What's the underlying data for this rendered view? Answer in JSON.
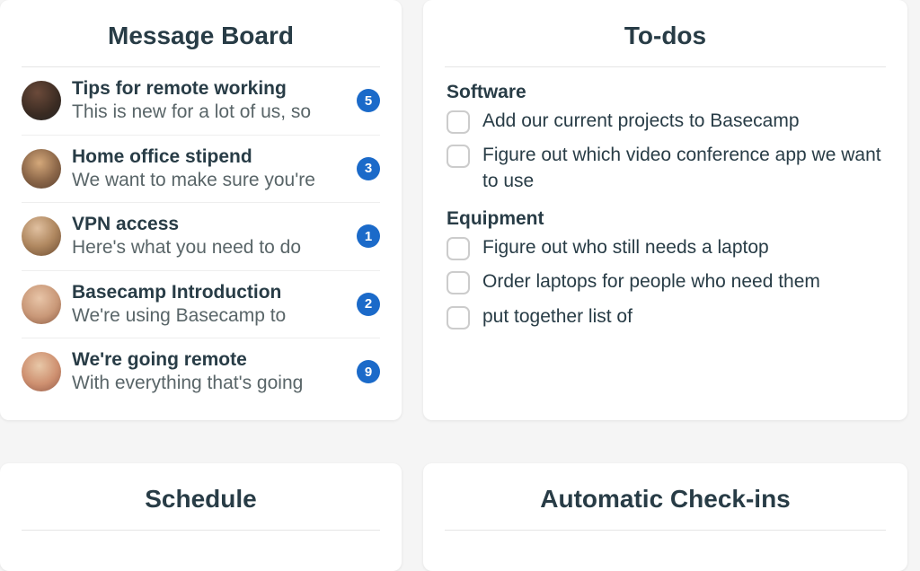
{
  "message_board": {
    "title": "Message Board",
    "items": [
      {
        "title": "Tips for remote working",
        "preview": "This is new for a lot of us, so",
        "count": "5"
      },
      {
        "title": "Home office stipend",
        "preview": "We want to make sure you're",
        "count": "3"
      },
      {
        "title": "VPN access",
        "preview": "Here's what you need to do",
        "count": "1"
      },
      {
        "title": "Basecamp Introduction",
        "preview": "We're using Basecamp to",
        "count": "2"
      },
      {
        "title": "We're going remote",
        "preview": "With everything that's going",
        "count": "9"
      }
    ]
  },
  "todos": {
    "title": "To-dos",
    "groups": [
      {
        "name": "Software",
        "items": [
          "Add our current projects to Basecamp",
          "Figure out which video conference app we want to use"
        ]
      },
      {
        "name": "Equipment",
        "items": [
          "Figure out who still needs a laptop",
          "Order laptops for people who need them",
          "put together list of"
        ]
      }
    ]
  },
  "schedule": {
    "title": "Schedule"
  },
  "checkins": {
    "title": "Automatic Check-ins"
  }
}
